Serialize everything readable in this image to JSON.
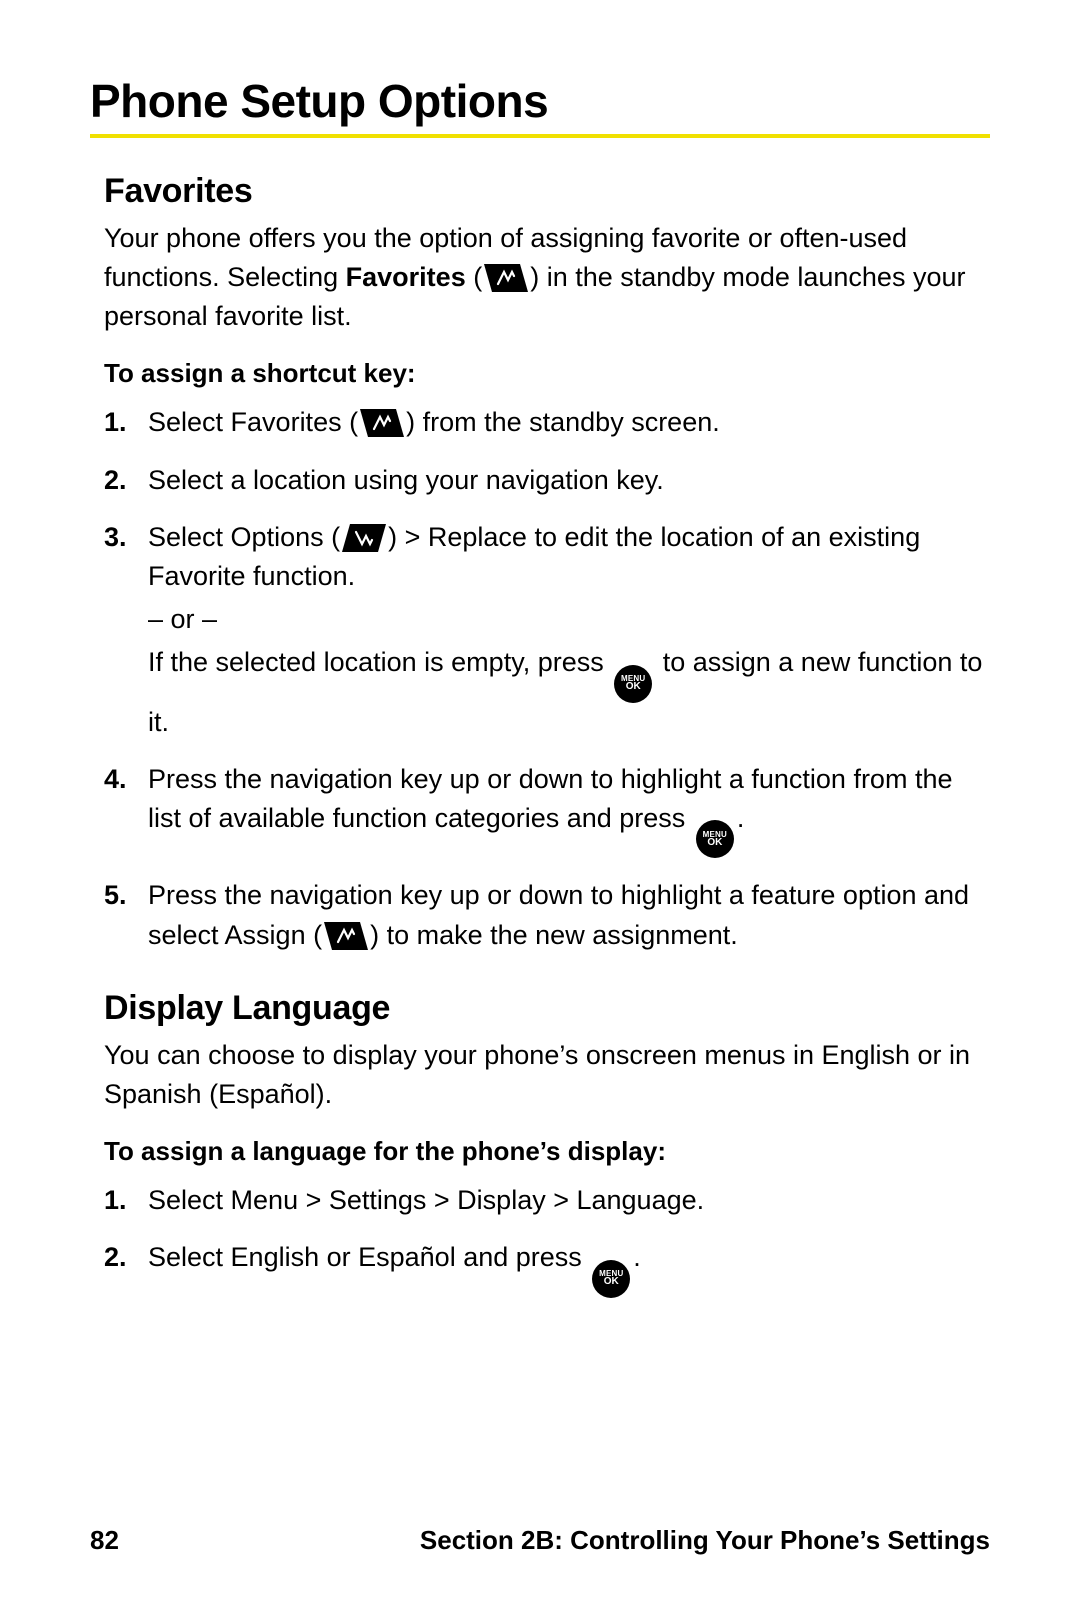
{
  "title": "Phone Setup Options",
  "favorites": {
    "heading": "Favorites",
    "intro1": "Your phone offers you the option of assigning favorite or often-used functions. Selecting ",
    "intro_bold": "Favorites",
    "intro2": " (",
    "intro3": ") in the standby mode launches your personal favorite list.",
    "sub": "To assign a shortcut key:",
    "s1a": "Select ",
    "s1b": "Favorites",
    "s1c": " (",
    "s1d": ") from the standby screen.",
    "s2": "Select a location using your navigation key.",
    "s3a": "Select ",
    "s3b": "Options",
    "s3c": " (",
    "s3d": ") ",
    "s3e": "> Replace",
    "s3f": " to edit the location of an existing Favorite function.",
    "s3or": "– or –",
    "s3g": "If the selected location is empty, press ",
    "s3h": " to assign a new function to it.",
    "s4a": "Press the navigation key up or down to highlight a function from the list of available function categories and press ",
    "s4b": ".",
    "s5a": "Press the navigation key up or down to highlight a feature option and select ",
    "s5b": "Assign",
    "s5c": " (",
    "s5d": ") to make the new assignment."
  },
  "display_language": {
    "heading": "Display Language",
    "intro": "You can choose to display your phone’s onscreen menus in English or in Spanish (Español).",
    "sub": "To assign a language for the phone’s display:",
    "s1a": "Select ",
    "s1b": "Menu > Settings > Display > Language",
    "s1c": ".",
    "s2a": "Select ",
    "s2b": "English",
    "s2c": " or ",
    "s2d": "Español",
    "s2e": " and press ",
    "s2f": "."
  },
  "footer": {
    "page": "82",
    "section": "Section 2B: Controlling Your Phone’s Settings"
  },
  "icons": {
    "softkey_left": "favorites-softkey-icon",
    "softkey_right": "options-softkey-icon",
    "menu_ok_top": "MENU",
    "menu_ok_bottom": "OK"
  }
}
